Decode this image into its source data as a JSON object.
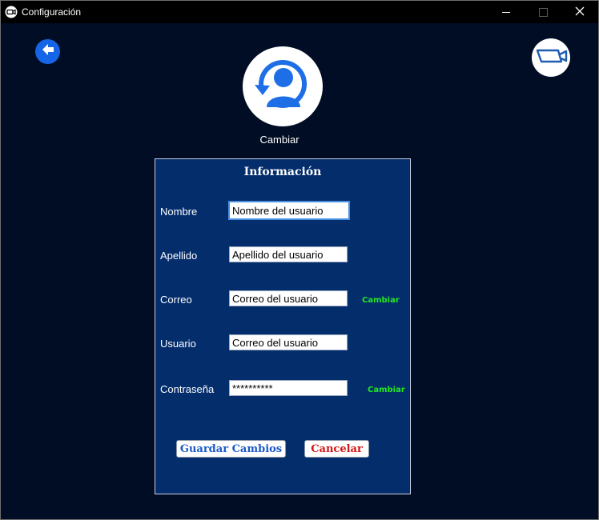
{
  "window": {
    "title": "Configuración",
    "app_icon": "video-camera-logo-icon",
    "controls": [
      "minimize-icon",
      "maximize-icon",
      "close-icon"
    ]
  },
  "toolbar": {
    "back_icon": "arrow-left-icon",
    "camera_icon": "video-camera-icon"
  },
  "profile": {
    "avatar_icon": "user-refresh-icon",
    "change_label": "Cambiar"
  },
  "form": {
    "title": "Información",
    "fields": [
      {
        "label": "Nombre",
        "value": "Nombre del usuario"
      },
      {
        "label": "Apellido",
        "value": "Apellido del usuario"
      },
      {
        "label": "Correo",
        "value": "Correo del usuario",
        "action": "Cambiar"
      },
      {
        "label": "Usuario",
        "value": "Correo del usuario"
      },
      {
        "label": "Contraseña",
        "value": "**********",
        "action": "Cambiar"
      }
    ],
    "save_label": "Guardar Cambios",
    "cancel_label": "Cancelar"
  },
  "colors": {
    "background": "#000d24",
    "panel": "#042d6c",
    "accent_blue": "#1565e6",
    "link_green": "#22e822",
    "cancel_red": "#d41616"
  }
}
